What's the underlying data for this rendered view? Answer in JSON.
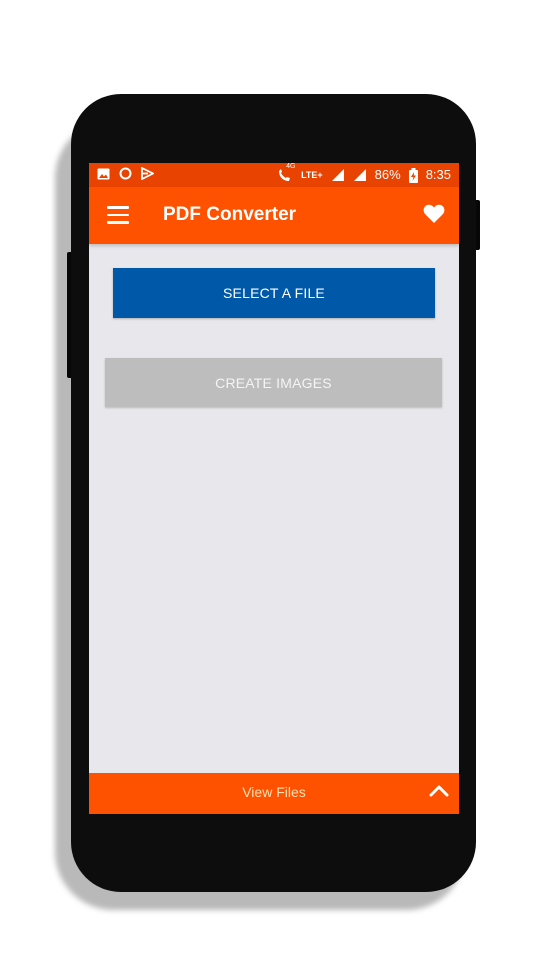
{
  "status_bar": {
    "network_label": "LTE+",
    "network_small": "4G",
    "battery": "86%",
    "time": "8:35",
    "icons": [
      "image-icon",
      "circle-icon",
      "notification-icon",
      "phone-wifi-icon",
      "signal-icon",
      "battery-charging-icon"
    ]
  },
  "app_bar": {
    "title": "PDF Converter",
    "menu_icon": "hamburger-icon",
    "action_icon": "heart-icon"
  },
  "main": {
    "select_file_label": "SELECT A FILE",
    "create_images_label": "CREATE IMAGES"
  },
  "bottom_bar": {
    "label": "View Files",
    "icon": "chevron-up-icon"
  },
  "colors": {
    "status_bar": "#e84300",
    "app_bar": "#ff5200",
    "primary_button": "#0059a8",
    "disabled_button": "#bdbdbd",
    "background": "#e8e8ec"
  }
}
